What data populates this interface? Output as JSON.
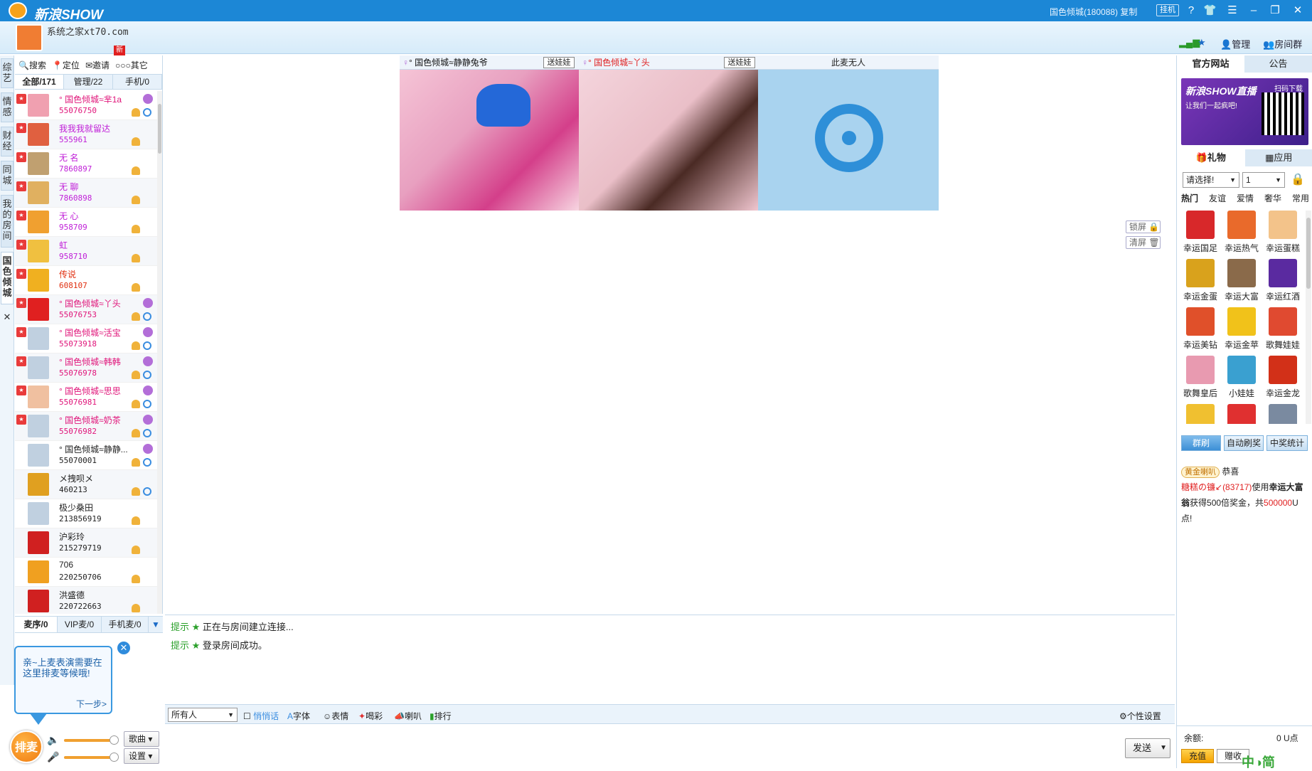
{
  "titlebar": {
    "app_title": "新浪SHOW",
    "user_info": "国色倾城(180088)",
    "copy": "复制",
    "hang_button": "挂机",
    "icons": [
      "help-icon",
      "shirt-icon",
      "menu-icon",
      "minimize-icon",
      "restore-icon",
      "close-icon"
    ]
  },
  "header": {
    "site": "系统之家xt70.com",
    "new_badge": "新",
    "manage": "管理",
    "room_group": "房间群"
  },
  "vtabs": [
    "综艺",
    "情感",
    "财经",
    "同城",
    "我的房间",
    "国色倾城"
  ],
  "vtab_close": "✕",
  "left": {
    "tools": [
      "搜索",
      "定位",
      "邀请",
      "其它"
    ],
    "tabs": [
      "全部/171",
      "管理/22",
      "手机/0"
    ],
    "users": [
      {
        "name": "° 国色倾城≈芈1a",
        "id": "55076750",
        "color": "#e0157a"
      },
      {
        "name": "我我我就留达",
        "id": "555961",
        "color": "#c020d8"
      },
      {
        "name": "无 名",
        "id": "7860897",
        "color": "#c020d8"
      },
      {
        "name": "无 聊",
        "id": "7860898",
        "color": "#c020d8"
      },
      {
        "name": "无 心",
        "id": "958709",
        "color": "#c020d8"
      },
      {
        "name": "虹",
        "id": "958710",
        "color": "#c020d8"
      },
      {
        "name": "传说",
        "id": "608107",
        "color": "#e03010"
      },
      {
        "name": "° 国色倾城≈丫头",
        "id": "55076753",
        "color": "#e0157a"
      },
      {
        "name": "° 国色倾城≈活宝",
        "id": "55073918",
        "color": "#e0157a"
      },
      {
        "name": "° 国色倾城≈韩韩",
        "id": "55076978",
        "color": "#e0157a"
      },
      {
        "name": "° 国色倾城≈思思",
        "id": "55076981",
        "color": "#e0157a"
      },
      {
        "name": "° 国色倾城≈奶茶",
        "id": "55076982",
        "color": "#e0157a"
      },
      {
        "name": "° 国色倾城≈静静...",
        "id": "55070001",
        "color": "#222222"
      },
      {
        "name": "メ拽呗メ",
        "id": "460213",
        "color": "#222222"
      },
      {
        "name": "极少桑田",
        "id": "213856919",
        "color": "#222222"
      },
      {
        "name": "沪彩玲",
        "id": "215279719",
        "color": "#222222"
      },
      {
        "name": "706",
        "id": "220250706",
        "color": "#222222"
      },
      {
        "name": "洪盛德",
        "id": "220722663",
        "color": "#222222"
      }
    ],
    "queue_tabs": [
      "麦序/0",
      "VIP麦/0",
      "手机麦/0"
    ],
    "bubble_text": "亲~上麦表演需要在这里排麦等候哦!",
    "bubble_next": "下一步>",
    "paimai": "排麦",
    "song_button": "歌曲",
    "settings_button": "设置"
  },
  "videos": [
    {
      "title": "° 国色倾城≈静静兔爷",
      "title_color": "#111111",
      "send": "送娃娃"
    },
    {
      "title": "° 国色倾城≈丫头",
      "title_color": "#e02020",
      "send": "送娃娃"
    },
    {
      "title": "此麦无人",
      "title_color": "#333333"
    }
  ],
  "screen_buttons": {
    "lock": "锁屏",
    "clear": "清屏"
  },
  "chat": [
    {
      "tip": "提示",
      "text": "正在与房间建立连接..."
    },
    {
      "tip": "提示",
      "text": "登录房间成功。"
    }
  ],
  "toolbar": {
    "target": "所有人",
    "private": "悄悄话",
    "font": "字体",
    "emoji": "表情",
    "color": "喝彩",
    "horn": "喇叭",
    "rank": "排行",
    "personal": "个性设置",
    "send": "发送"
  },
  "right": {
    "tabs": [
      "官方网站",
      "公告"
    ],
    "banner_title": "新浪SHOW直播",
    "banner_sub": "让我们一起疯吧!",
    "banner_scan": "扫码下载",
    "gift_tabs": [
      "礼物",
      "应用"
    ],
    "select1": "请选择!",
    "select2": "1",
    "categories": [
      "热门",
      "友谊",
      "爱情",
      "奢华",
      "常用"
    ],
    "gifts": [
      {
        "label": "幸运国足",
        "color": "#d8282a"
      },
      {
        "label": "幸运热气",
        "color": "#e96a2b"
      },
      {
        "label": "幸运蛋糕",
        "color": "#f3c38a"
      },
      {
        "label": "幸运金蛋",
        "color": "#d9a21c"
      },
      {
        "label": "幸运大富",
        "color": "#8a6a4a"
      },
      {
        "label": "幸运红酒",
        "color": "#5a2aa0"
      },
      {
        "label": "幸运美钻",
        "color": "#e0502a"
      },
      {
        "label": "幸运金苹",
        "color": "#f1c21a"
      },
      {
        "label": "歌舞娃娃",
        "color": "#e04a30"
      },
      {
        "label": "歌舞皇后",
        "color": "#e89ab0"
      },
      {
        "label": "小娃娃",
        "color": "#3aa0d0"
      },
      {
        "label": "幸运金龙",
        "color": "#d23018"
      },
      {
        "label": "",
        "color": "#f0c030"
      },
      {
        "label": "",
        "color": "#e03030"
      },
      {
        "label": "",
        "color": "#7a8aa0"
      }
    ],
    "buttons": [
      "群刷",
      "自动刷奖",
      "中奖统计"
    ],
    "news_badge": "黄金喇叭",
    "news_text1": "恭喜",
    "news_user": "糖糕の镰↙",
    "news_id": "(83717)",
    "news_text2": "使用",
    "news_gift": "幸运大富翁",
    "news_text3": "获得500倍奖金，共",
    "news_amount": "500000",
    "news_unit": "U点!",
    "balance_label": "余额:",
    "balance_value": "0 U点",
    "charge": "充值",
    "charge2": "赠收"
  },
  "watermark": "中◑简"
}
